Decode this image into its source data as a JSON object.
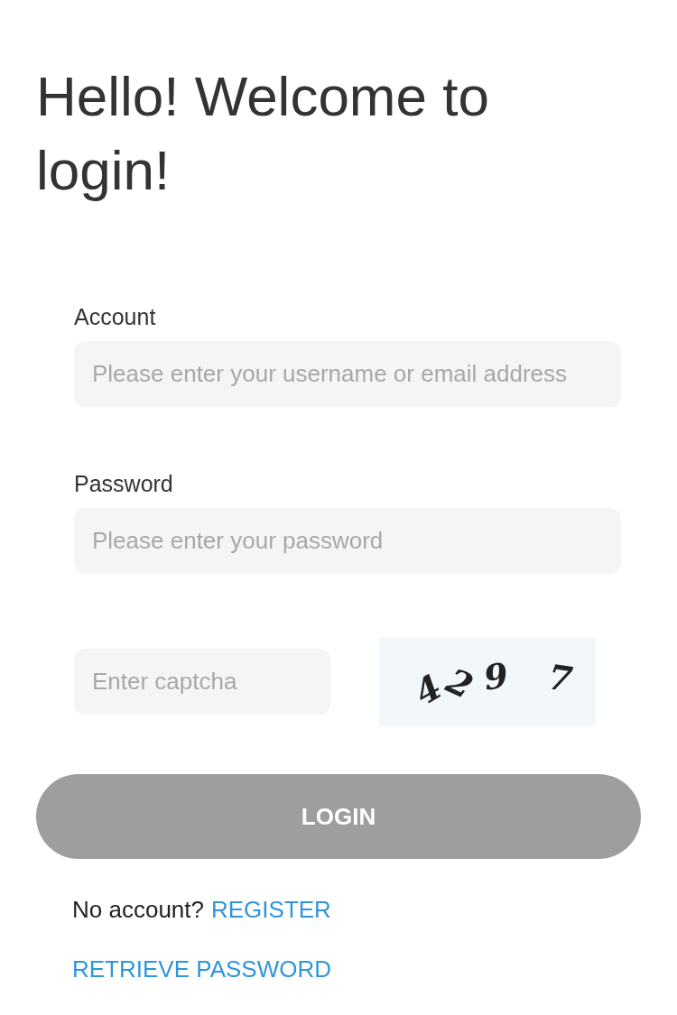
{
  "title": "Hello! Welcome to login!",
  "fields": [
    {
      "label": "Account",
      "placeholder": "Please enter your username or email address"
    },
    {
      "label": "Password",
      "placeholder": "Please enter your password"
    }
  ],
  "captcha": {
    "placeholder": "Enter captcha",
    "characters": [
      "4",
      "2",
      "9",
      "7"
    ]
  },
  "login_button": "LOGIN",
  "register": {
    "prompt": "No account?",
    "link": "REGISTER"
  },
  "retrieve_link": "RETRIEVE PASSWORD"
}
